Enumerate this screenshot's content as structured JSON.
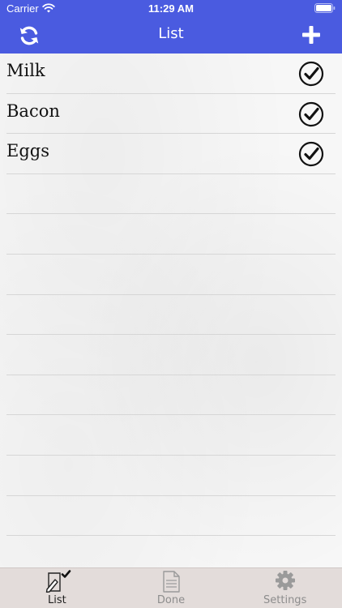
{
  "status_bar": {
    "carrier": "Carrier",
    "time": "11:29 AM"
  },
  "nav": {
    "title": "List",
    "left_icon": "refresh-icon",
    "right_icon": "plus-icon"
  },
  "list": {
    "items": [
      {
        "label": "Milk",
        "icon": "check-circle-icon"
      },
      {
        "label": "Bacon",
        "icon": "check-circle-icon"
      },
      {
        "label": "Eggs",
        "icon": "check-circle-icon"
      }
    ]
  },
  "tab_bar": {
    "tabs": [
      {
        "label": "List",
        "icon": "pencil-check-icon",
        "active": true
      },
      {
        "label": "Done",
        "icon": "document-icon",
        "active": false
      },
      {
        "label": "Settings",
        "icon": "gear-icon",
        "active": false
      }
    ]
  },
  "colors": {
    "header": "#4a5be0",
    "tab_bar": "#e3dcda",
    "active_tab": "#222222",
    "inactive_tab": "#8d8d8d"
  }
}
